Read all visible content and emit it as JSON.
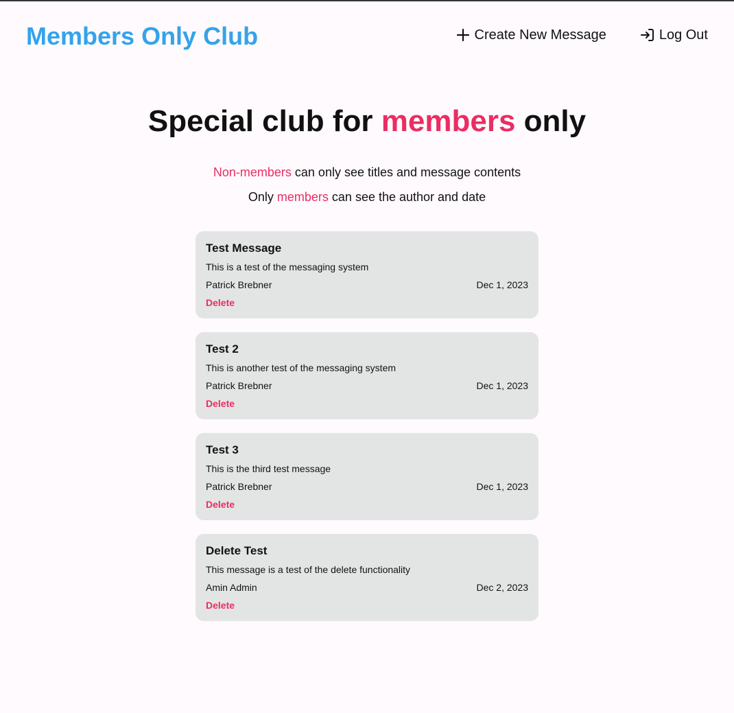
{
  "header": {
    "brand": "Members Only Club",
    "nav": {
      "create_label": "Create New Message",
      "logout_label": "Log Out"
    }
  },
  "hero": {
    "title_before": "Special club for ",
    "title_accent": "members",
    "title_after": " only",
    "line1_accent": "Non-members",
    "line1_rest": " can only see titles and message contents",
    "line2_before": "Only ",
    "line2_accent": "members",
    "line2_rest": " can see the author and date"
  },
  "messages": [
    {
      "title": "Test Message",
      "body": "This is a test of the messaging system",
      "author": "Patrick Brebner",
      "date": "Dec 1, 2023",
      "delete_label": "Delete"
    },
    {
      "title": "Test 2",
      "body": "This is another test of the messaging system",
      "author": "Patrick Brebner",
      "date": "Dec 1, 2023",
      "delete_label": "Delete"
    },
    {
      "title": "Test 3",
      "body": "This is the third test message",
      "author": "Patrick Brebner",
      "date": "Dec 1, 2023",
      "delete_label": "Delete"
    },
    {
      "title": "Delete Test",
      "body": "This message is a test of the delete functionality",
      "author": "Amin Admin",
      "date": "Dec 2, 2023",
      "delete_label": "Delete"
    }
  ],
  "colors": {
    "brand": "#34a3ea",
    "accent": "#ea2d63",
    "card_background": "#e3e5e4",
    "page_background": "#fffafd"
  },
  "icons": {
    "create": "plus-icon",
    "logout": "log-in-arrow-icon"
  }
}
